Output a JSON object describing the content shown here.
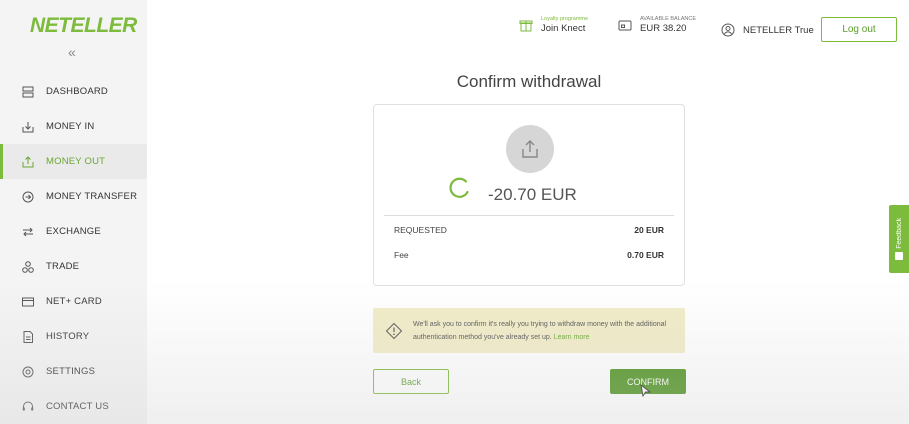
{
  "brand": {
    "logo": "NETELLER",
    "accent": "#7dbb3c",
    "collapse_symbol": "«"
  },
  "sidebar": {
    "items": [
      {
        "label": "DASHBOARD",
        "icon": "dashboard-icon",
        "active": false
      },
      {
        "label": "MONEY IN",
        "icon": "money-in-icon",
        "active": false
      },
      {
        "label": "MONEY OUT",
        "icon": "money-out-icon",
        "active": true
      },
      {
        "label": "MONEY TRANSFER",
        "icon": "money-transfer-icon",
        "active": false
      },
      {
        "label": "EXCHANGE",
        "icon": "exchange-icon",
        "active": false
      },
      {
        "label": "TRADE",
        "icon": "trade-icon",
        "active": false
      },
      {
        "label": "NET+ CARD",
        "icon": "card-icon",
        "active": false
      },
      {
        "label": "HISTORY",
        "icon": "history-icon",
        "active": false
      },
      {
        "label": "SETTINGS",
        "icon": "settings-icon",
        "active": false
      },
      {
        "label": "CONTACT US",
        "icon": "contact-icon",
        "active": false
      }
    ]
  },
  "header": {
    "loyalty_small": "Loyalty programme",
    "loyalty_big": "Join Knect",
    "balance_small": "AVAILABLE BALANCE",
    "balance_big": "EUR 38.20",
    "user_name": "NETELLER True",
    "logout_label": "Log out"
  },
  "main": {
    "title": "Confirm withdrawal",
    "amount": "-20.70 EUR",
    "rows": [
      {
        "label": "REQUESTED",
        "value": "20 EUR"
      },
      {
        "label": "Fee",
        "value": "0.70 EUR"
      }
    ],
    "info_text": "We'll ask you to confirm it's really you trying to withdraw money with the additional authentication method you've already set up.",
    "info_link": "Learn more",
    "back_label": "Back",
    "confirm_label": "CONFIRM"
  },
  "feedback": {
    "label": "Feedback"
  }
}
